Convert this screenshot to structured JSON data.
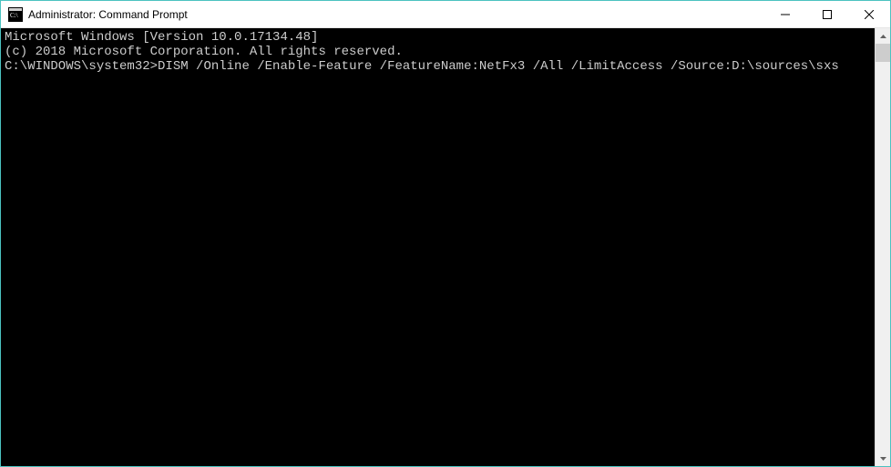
{
  "window": {
    "title": "Administrator: Command Prompt"
  },
  "terminal": {
    "line1": "Microsoft Windows [Version 10.0.17134.48]",
    "line2": "(c) 2018 Microsoft Corporation. All rights reserved.",
    "blank": "",
    "prompt": "C:\\WINDOWS\\system32>",
    "command": "DISM /Online /Enable-Feature /FeatureName:NetFx3 /All /LimitAccess /Source:D:\\sources\\sxs"
  }
}
